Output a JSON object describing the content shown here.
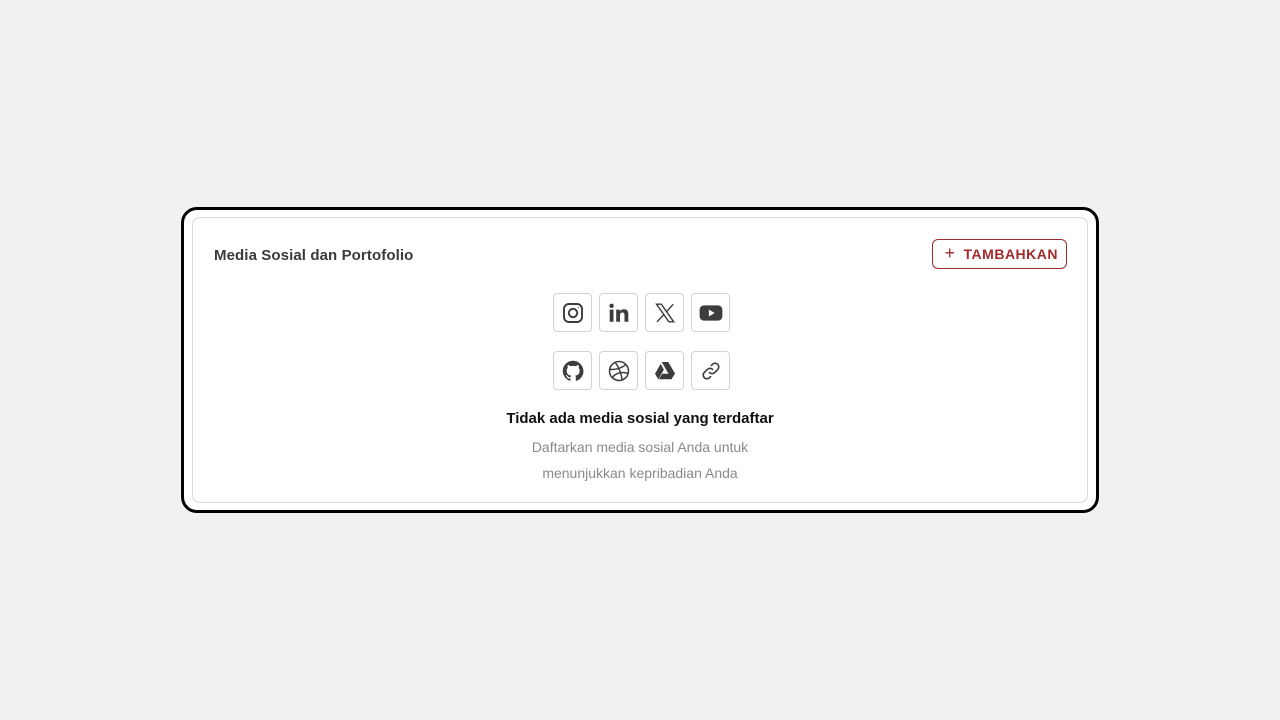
{
  "section": {
    "title": "Media Sosial dan Portofolio",
    "add_button": {
      "icon": "plus-icon",
      "label": "TAMBAHKAN"
    }
  },
  "icons": {
    "row1": [
      "instagram-icon",
      "linkedin-icon",
      "x-icon",
      "youtube-icon"
    ],
    "row2": [
      "github-icon",
      "dribbble-icon",
      "google-drive-icon",
      "link-icon"
    ]
  },
  "empty_state": {
    "title": "Tidak ada media sosial yang terdaftar",
    "description_line1": "Daftarkan media sosial Anda untuk",
    "description_line2": "menunjukkan kepribadian Anda"
  },
  "colors": {
    "accent": "#a12b2b",
    "icon": "#3c3c3c",
    "muted_text": "#8a8a8a",
    "background": "#f1f1f1"
  }
}
